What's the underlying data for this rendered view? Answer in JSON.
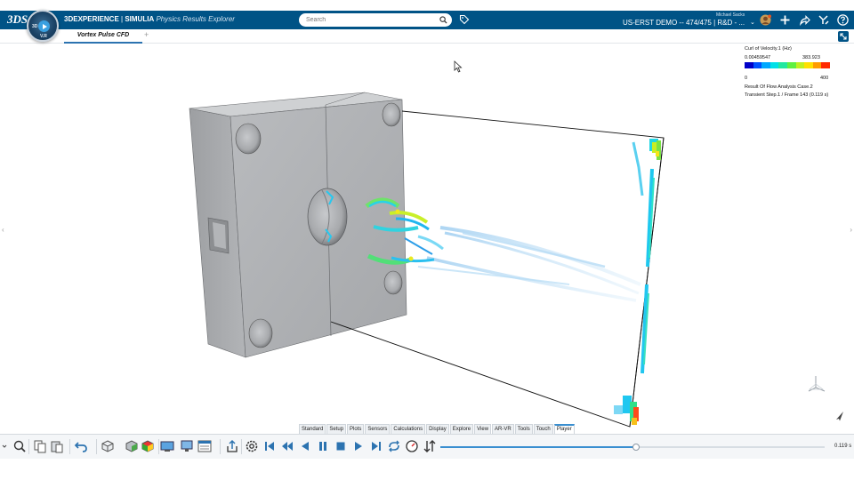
{
  "topbar": {
    "brand_left": "3DEXPERIENCE",
    "brand_sep": " | ",
    "brand_company": "SIMULIA",
    "brand_app": "Physics Results Explorer",
    "search_placeholder": "Search",
    "user_name": "Michael Sacks",
    "collab_space": "US-ERST DEMO -- 474/475 | R&D - ...",
    "compass_top": "3D",
    "compass_bottom": "V.R",
    "accent_color": "#005386"
  },
  "tabs": {
    "active_label": "Vortex Pulse CFD",
    "add_label": "+"
  },
  "legend": {
    "title": "Curl of Velocity.1 (Hz)",
    "value_min": "0.00459547",
    "value_max": "383.923",
    "tick_min": "0",
    "tick_max": "400",
    "result_name": "Result Of Flow Analysis Case.2",
    "step_info": "Transient Step.1 / Frame 143 (0.119 s)",
    "colors": [
      "#0000c8",
      "#0050ff",
      "#00a8ff",
      "#00e0e8",
      "#22e8a0",
      "#60f040",
      "#c0f020",
      "#ffe000",
      "#ff9c00",
      "#ff2a00"
    ]
  },
  "section_tabs": [
    "Standard",
    "Setup",
    "Plots",
    "Sensors",
    "Calculations",
    "Display",
    "Explore",
    "View",
    "AR-VR",
    "Tools",
    "Touch",
    "Player"
  ],
  "active_section_tab": "Player",
  "player": {
    "time_label": "0.119 s",
    "progress_fraction": 0.51
  }
}
